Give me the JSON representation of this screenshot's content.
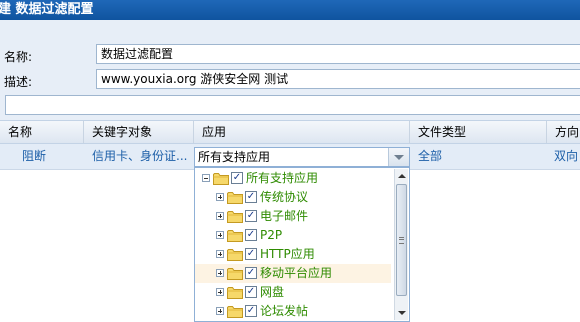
{
  "title": "建 数据过滤配置",
  "form": {
    "name_label": "名称:",
    "name_value": "数据过滤配置",
    "desc_label": "描述:",
    "desc_value": "www.youxia.org 游侠安全网 测试",
    "third_value": ""
  },
  "grid": {
    "columns": [
      "名称",
      "关键字对象",
      "应用",
      "文件类型",
      "方向"
    ],
    "row": {
      "name": "阻断",
      "keywords": "信用卡、身份证...",
      "app": "所有支持应用",
      "file_type": "全部",
      "direction": "双向"
    }
  },
  "tree": {
    "root": "所有支持应用",
    "children": [
      "传统协议",
      "电子邮件",
      "P2P",
      "HTTP应用",
      "移动平台应用",
      "网盘",
      "论坛发帖"
    ]
  },
  "icons": {
    "expand": "expand-toggle-icon",
    "folder": "folder-icon",
    "check": "checkbox-icon",
    "dropdown": "chevron-down-icon"
  },
  "colors": {
    "titlebar": "#1565b5",
    "panel": "#e7eef7",
    "tree_text": "#2e8b00",
    "link_text": "#1d5fa8"
  }
}
